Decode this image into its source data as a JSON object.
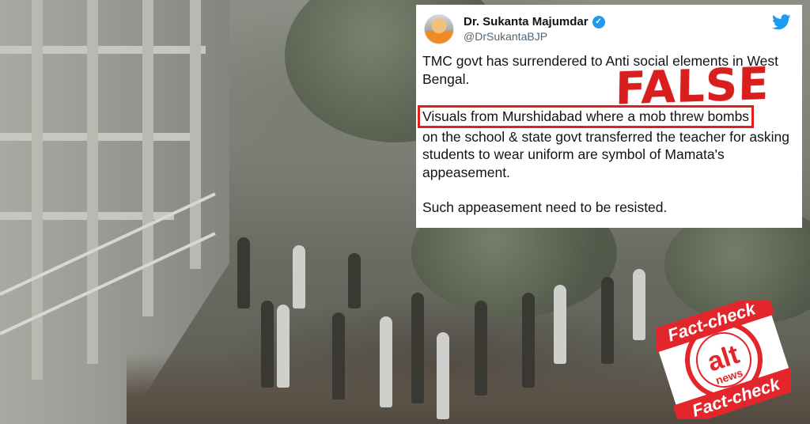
{
  "tweet": {
    "display_name": "Dr. Sukanta Majumdar",
    "handle": "@DrSukantaBJP",
    "paragraph1": "TMC govt has surrendered to Anti social elements in West Bengal.",
    "highlight_line": "Visuals from Murshidabad where a mob threw bombs",
    "paragraph2_rest": "on the school & state govt transferred the teacher for asking students to wear uniform are symbol of Mamata's appeasement.",
    "paragraph3": "Such appeasement need to be resisted.",
    "verified_icon": "verified-badge-icon",
    "brand_icon": "twitter-bird-icon"
  },
  "verdict": {
    "label": "FALSE",
    "color": "#d91e1e"
  },
  "stamp": {
    "top_text": "Fact-check",
    "bottom_text": "Fact-check",
    "logo_text": "alt",
    "logo_sub": "news",
    "color": "#e3262b"
  },
  "colors": {
    "highlight_border": "#e0201f",
    "verified_blue": "#1d9bf0"
  }
}
